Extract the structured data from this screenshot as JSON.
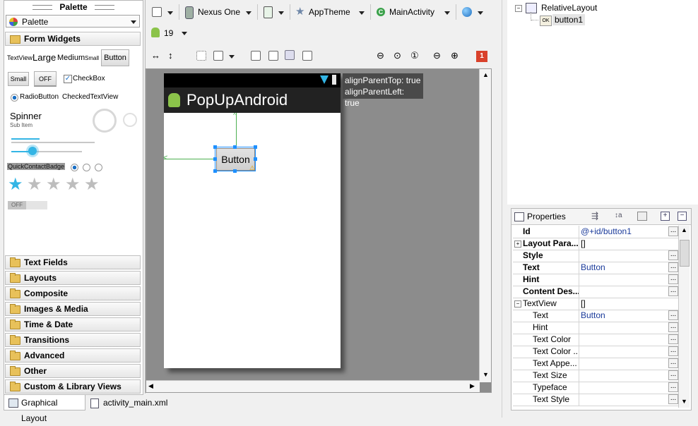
{
  "palette": {
    "title": "Palette",
    "selector_label": "Palette",
    "open_category": "Form Widgets",
    "widgets": {
      "textview": "TextView",
      "large": "Large",
      "medium": "Medium",
      "small": "Small",
      "button": "Button",
      "small_button": "Small",
      "toggle_off": "OFF",
      "checkbox": "CheckBox",
      "radiobutton": "RadioButton",
      "checkedtextview": "CheckedTextView",
      "spinner": "Spinner",
      "spinner_sub": "Sub Item",
      "quickcontactbadge": "QuickContactBadge",
      "switch_off": "OFF"
    },
    "categories": [
      "Text Fields",
      "Layouts",
      "Composite",
      "Images & Media",
      "Time & Date",
      "Transitions",
      "Advanced",
      "Other",
      "Custom & Library Views"
    ]
  },
  "toolbar": {
    "device": "Nexus One",
    "theme": "AppTheme",
    "activity": "MainActivity",
    "api_level": "19",
    "error_count": "1"
  },
  "device": {
    "app_title": "PopUpAndroid",
    "button_label": "Button"
  },
  "tooltip": {
    "line1": "alignParentTop: true",
    "line2": "alignParentLeft: true"
  },
  "outline": {
    "root": "RelativeLayout",
    "child": "button1"
  },
  "properties": {
    "title": "Properties",
    "rows": [
      {
        "name": "Id",
        "value": "@+id/button1",
        "bold": true
      },
      {
        "name": "Layout Para...",
        "value": "[]",
        "bold": true
      },
      {
        "name": "Style",
        "value": "",
        "bold": true
      },
      {
        "name": "Text",
        "value": "Button",
        "bold": true
      },
      {
        "name": "Hint",
        "value": "",
        "bold": true
      },
      {
        "name": "Content Des...",
        "value": "",
        "bold": true
      },
      {
        "name": "TextView",
        "value": "[]",
        "bold": false
      },
      {
        "name": "Text",
        "value": "Button",
        "bold": false
      },
      {
        "name": "Hint",
        "value": "",
        "bold": false
      },
      {
        "name": "Text Color",
        "value": "",
        "bold": false
      },
      {
        "name": "Text Color ...",
        "value": "",
        "bold": false
      },
      {
        "name": "Text Appe...",
        "value": "",
        "bold": false
      },
      {
        "name": "Text Size",
        "value": "",
        "bold": false
      },
      {
        "name": "Typeface",
        "value": "",
        "bold": false
      },
      {
        "name": "Text Style",
        "value": "",
        "bold": false
      }
    ]
  },
  "tabs": {
    "graphical": "Graphical Layout",
    "xml": "activity_main.xml"
  },
  "colors": {
    "actionbar": "#222222",
    "accent_blue": "#33b5e5",
    "error_red": "#d9412b"
  }
}
